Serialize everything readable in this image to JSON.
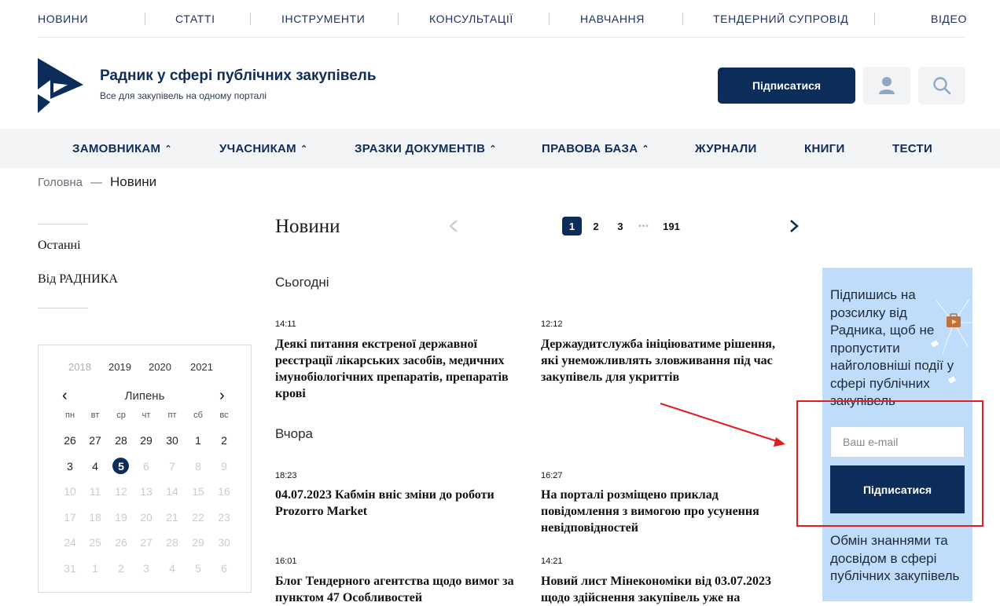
{
  "top_nav": [
    "НОВИНИ",
    "СТАТТІ",
    "ІНСТРУМЕНТИ",
    "КОНСУЛЬТАЦІЇ",
    "НАВЧАННЯ",
    "ТЕНДЕРНИЙ СУПРОВІД",
    "ВІДЕО"
  ],
  "header": {
    "title": "Радник у сфері публічних закупівель",
    "subtitle": "Все для закупівель на одному порталі",
    "subscribe_label": "Підписатися",
    "user_icon": "user-icon",
    "search_icon": "search-icon"
  },
  "main_menu": [
    {
      "label": "ЗАМОВНИКАМ",
      "dropdown": true
    },
    {
      "label": "УЧАСНИКАМ",
      "dropdown": true
    },
    {
      "label": "ЗРАЗКИ ДОКУМЕНТІВ",
      "dropdown": true
    },
    {
      "label": "ПРАВОВА БАЗА",
      "dropdown": true
    },
    {
      "label": "ЖУРНАЛИ",
      "dropdown": false
    },
    {
      "label": "КНИГИ",
      "dropdown": false
    },
    {
      "label": "ТЕСТИ",
      "dropdown": false
    }
  ],
  "breadcrumb": {
    "home": "Головна",
    "separator": "—",
    "current": "Новини"
  },
  "sidebar": {
    "items": [
      "Останні",
      "Від РАДНИКА"
    ]
  },
  "calendar": {
    "years": [
      "2018",
      "2019",
      "2020",
      "2021"
    ],
    "month": "Липень",
    "weekdays": [
      "пн",
      "вт",
      "ср",
      "чт",
      "пт",
      "сб",
      "вс"
    ],
    "weeks": [
      [
        "26",
        "27",
        "28",
        "29",
        "30",
        "1",
        "2"
      ],
      [
        "3",
        "4",
        "5",
        "6",
        "7",
        "8",
        "9"
      ],
      [
        "10",
        "11",
        "12",
        "13",
        "14",
        "15",
        "16"
      ],
      [
        "17",
        "18",
        "19",
        "20",
        "21",
        "22",
        "23"
      ],
      [
        "24",
        "25",
        "26",
        "27",
        "28",
        "29",
        "30"
      ],
      [
        "31",
        "1",
        "2",
        "3",
        "4",
        "5",
        "6"
      ]
    ],
    "selected_day": "5"
  },
  "content": {
    "title": "Новини",
    "pagination": {
      "pages": [
        "1",
        "2",
        "3"
      ],
      "ellipsis": "•••",
      "last": "191",
      "current": "1"
    },
    "sections": [
      {
        "label": "Сьогодні",
        "items": [
          {
            "time": "14:11",
            "title": "Деякі питання екстреної державної реєстрації лікарських засобів, медичних імунобіологічних препаратів, препаратів крові"
          },
          {
            "time": "12:12",
            "title": "Держаудитслужба ініціюватиме рішення, які унеможливлять зловживання під час закупівель для укриттів"
          }
        ]
      },
      {
        "label": "Вчора",
        "items": [
          {
            "time": "18:23",
            "title": "04.07.2023 Кабмін вніс зміни до роботи Prozorro Market"
          },
          {
            "time": "16:27",
            "title": "На порталі розміщено приклад повідомлення з вимогою про усунення невідповідностей"
          },
          {
            "time": "16:01",
            "title": "Блог Тендерного агентства щодо вимог за пунктом 47 Особливостей"
          },
          {
            "time": "14:21",
            "title": "Новий лист Мінекономіки від 03.07.2023 щодо здійснення закупівель уже на"
          }
        ]
      }
    ]
  },
  "promo": {
    "text": "Підпишись на розсилку від Радника, щоб не пропустити найголовніші події у сфері публічних закупівель",
    "email_placeholder": "Ваш e-mail",
    "button_label": "Підписатися",
    "text2": "Обмін знаннями та досвідом в сфері публічних закупівель"
  },
  "colors": {
    "brand": "#0c2d5a",
    "promo_bg": "#bfdcfa",
    "annotation": "#e11d1d"
  }
}
